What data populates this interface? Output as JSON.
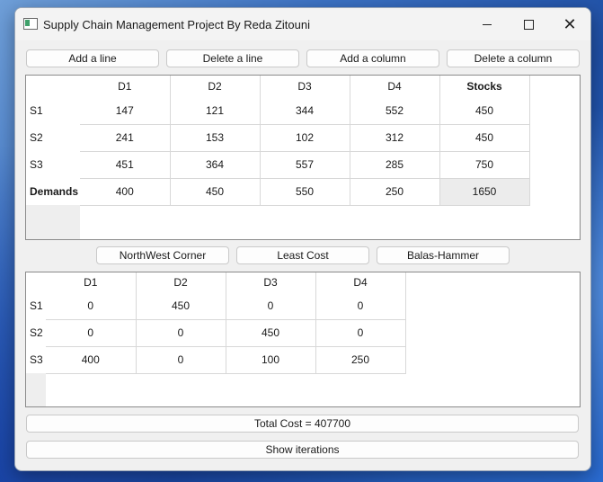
{
  "window": {
    "title": "Supply Chain Management Project By Reda Zitouni"
  },
  "toolbar": {
    "add_line": "Add a line",
    "delete_line": "Delete a line",
    "add_column": "Add a column",
    "delete_column": "Delete a column"
  },
  "input_table": {
    "columns": [
      "D1",
      "D2",
      "D3",
      "D4",
      "Stocks"
    ],
    "rows": [
      {
        "label": "S1",
        "cells": [
          "147",
          "121",
          "344",
          "552",
          "450"
        ]
      },
      {
        "label": "S2",
        "cells": [
          "241",
          "153",
          "102",
          "312",
          "450"
        ]
      },
      {
        "label": "S3",
        "cells": [
          "451",
          "364",
          "557",
          "285",
          "750"
        ]
      },
      {
        "label": "Demands",
        "cells": [
          "400",
          "450",
          "550",
          "250",
          "1650"
        ]
      }
    ]
  },
  "methods": {
    "northwest": "NorthWest Corner",
    "least_cost": "Least Cost",
    "balas_hammer": "Balas-Hammer"
  },
  "result_table": {
    "columns": [
      "D1",
      "D2",
      "D3",
      "D4"
    ],
    "rows": [
      {
        "label": "S1",
        "cells": [
          "0",
          "450",
          "0",
          "0"
        ]
      },
      {
        "label": "S2",
        "cells": [
          "0",
          "0",
          "450",
          "0"
        ]
      },
      {
        "label": "S3",
        "cells": [
          "400",
          "0",
          "100",
          "250"
        ]
      }
    ]
  },
  "total_cost": "Total Cost = 407700",
  "show_iterations": "Show iterations"
}
